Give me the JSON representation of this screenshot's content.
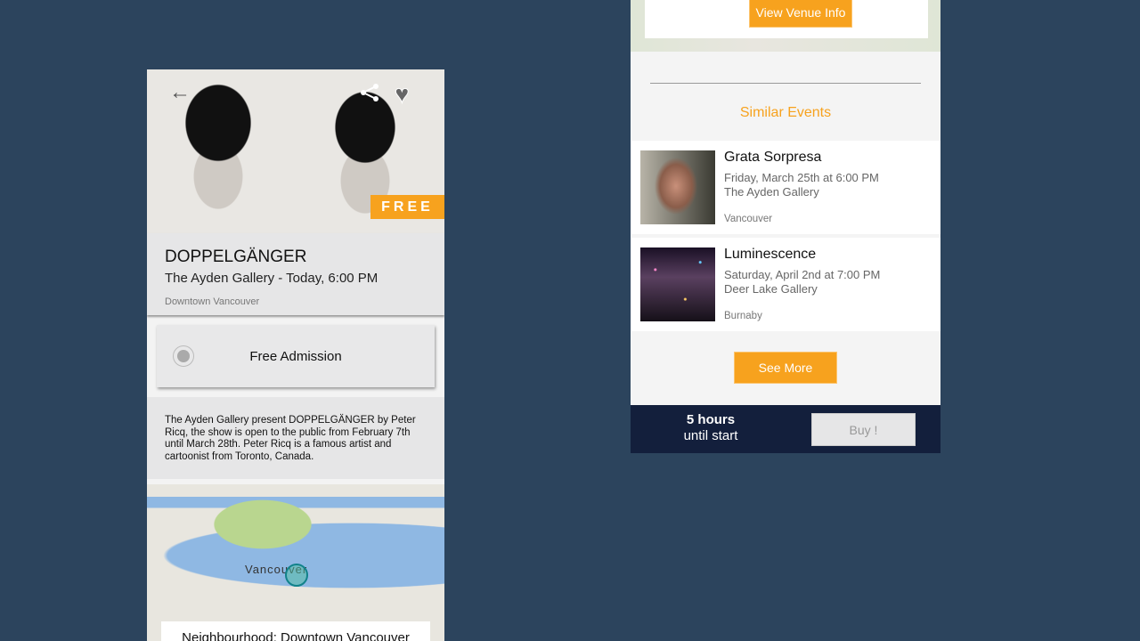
{
  "colors": {
    "background": "#2c445d",
    "accent": "#f7a21e",
    "footer": "#131f3c"
  },
  "event": {
    "badge": "FREE",
    "title": "DOPPELGÄNGER",
    "subtitle": "The Ayden Gallery - Today, 6:00 PM",
    "neighbourhood": "Downtown Vancouver",
    "ticket_option": "Free Admission",
    "description": "The Ayden Gallery present DOPPELGÄNGER by Peter Ricq, the show is open to the public from February 7th until March 28th. Peter Ricq is a famous artist and cartoonist from Toronto, Canada.",
    "map_city": "Vancouver",
    "neighbourhood_label": "Neighbourhood: Downtown Vancouver"
  },
  "icons": {
    "back": "arrow-left-icon",
    "share": "share-icon",
    "favorite": "heart-icon"
  },
  "venue": {
    "button": "View Venue Info"
  },
  "similar": {
    "heading": "Similar Events",
    "items": [
      {
        "title": "Grata Sorpresa",
        "date": "Friday, March 25th at 6:00 PM",
        "venue": "The Ayden Gallery",
        "city": "Vancouver"
      },
      {
        "title": "Luminescence",
        "date": "Saturday, April 2nd at 7:00 PM",
        "venue": "Deer Lake Gallery",
        "city": "Burnaby"
      }
    ],
    "see_more": "See More"
  },
  "footer": {
    "hours": "5 hours",
    "until": "until start",
    "buy": "Buy !"
  }
}
